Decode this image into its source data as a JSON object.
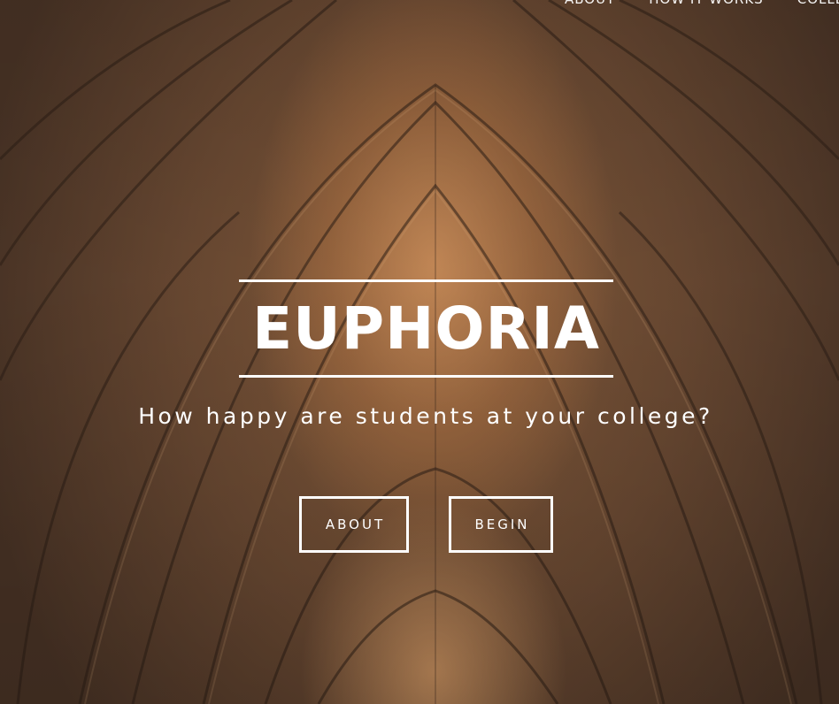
{
  "nav": {
    "items": [
      {
        "label": "ABOUT"
      },
      {
        "label": "HOW IT WORKS"
      },
      {
        "label": "COLLEGES"
      }
    ]
  },
  "hero": {
    "title": "EUPHORIA",
    "subtitle": "How happy are students at your college?",
    "buttons": {
      "about_label": "ABOUT",
      "begin_label": "BEGIN"
    }
  },
  "colors": {
    "text": "#ffffff",
    "background_dark": "#4a3426",
    "background_warm": "#c98a55"
  }
}
